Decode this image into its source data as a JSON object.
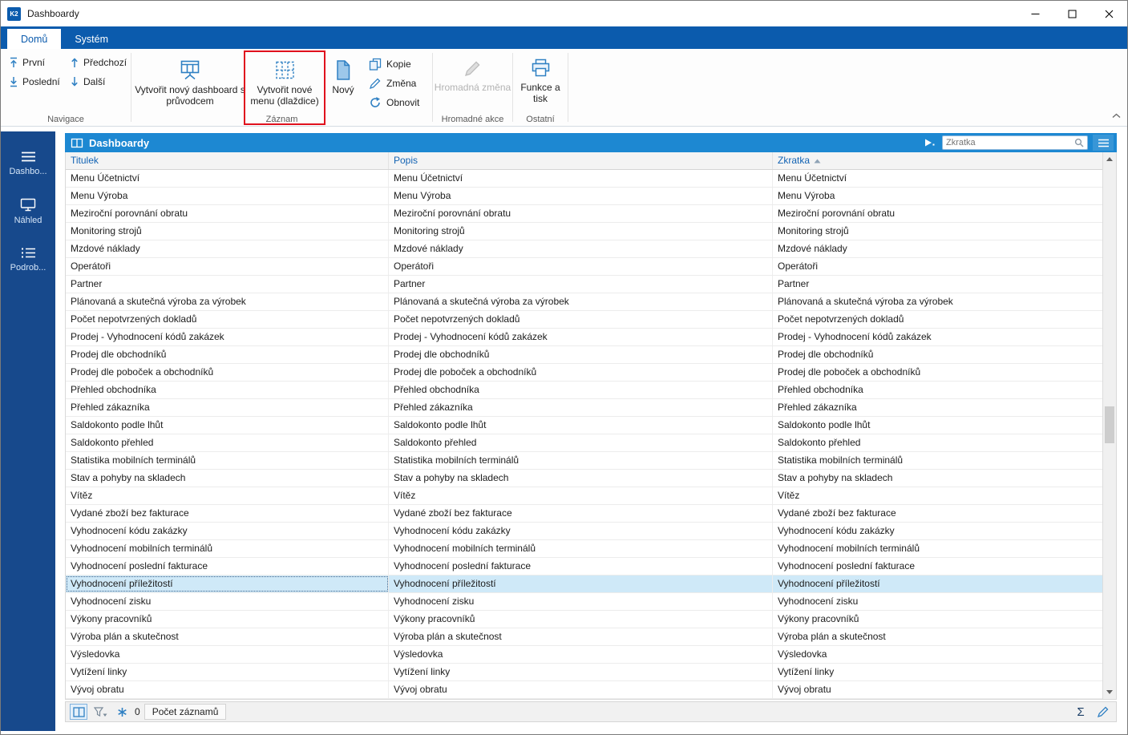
{
  "window": {
    "logo": "K2",
    "title": "Dashboardy"
  },
  "ribbon": {
    "tabs": [
      {
        "label": "Domů"
      },
      {
        "label": "Systém"
      }
    ],
    "navigace": {
      "label": "Navigace",
      "items": [
        {
          "label": "První"
        },
        {
          "label": "Poslední"
        },
        {
          "label": "Předchozí"
        },
        {
          "label": "Další"
        }
      ]
    },
    "zaznam": {
      "label": "Záznam",
      "create_dashboard": "Vytvořit nový dashboard s průvodcem",
      "create_menu": "Vytvořit nové menu (dlaždice)",
      "novy": "Nový",
      "kopie": "Kopie",
      "zmena": "Změna",
      "obnovit": "Obnovit"
    },
    "hromadne_akce": {
      "label": "Hromadné akce",
      "hromadna_zmena": "Hromadná změna"
    },
    "ostatni": {
      "label": "Ostatní",
      "funkce_a_tisk": "Funkce a tisk"
    }
  },
  "sidebar": {
    "items": [
      {
        "label": "Dashbo..."
      },
      {
        "label": "Náhled"
      },
      {
        "label": "Podrob..."
      }
    ]
  },
  "table": {
    "title": "Dashboardy",
    "search_placeholder": "Zkratka",
    "columns": [
      {
        "label": "Titulek"
      },
      {
        "label": "Popis"
      },
      {
        "label": "Zkratka",
        "sorted": "asc"
      }
    ],
    "selected_row": "Vyhodnocení příležitostí",
    "rows": [
      "Menu Účetnictví",
      "Menu Výroba",
      "Meziroční porovnání obratu",
      "Monitoring strojů",
      "Mzdové náklady",
      "Operátoři",
      "Partner",
      "Plánovaná a skutečná výroba za výrobek",
      "Počet nepotvrzených dokladů",
      "Prodej - Vyhodnocení kódů zakázek",
      "Prodej dle obchodníků",
      "Prodej dle poboček a obchodníků",
      "Přehled obchodníka",
      "Přehled zákazníka",
      "Saldokonto podle lhůt",
      "Saldokonto přehled",
      "Statistika mobilních terminálů",
      "Stav a pohyby na skladech",
      "Vítěz",
      "Vydané zboží bez fakturace",
      "Vyhodnocení kódu zakázky",
      "Vyhodnocení mobilních terminálů",
      "Vyhodnocení poslední fakturace",
      "Vyhodnocení příležitostí",
      "Vyhodnocení zisku",
      "Výkony pracovníků",
      "Výroba plán a skutečnost",
      "Výsledovka",
      "Vytížení linky",
      "Vývoj obratu"
    ]
  },
  "statusbar": {
    "filter_count": "0",
    "records_button": "Počet záznamů"
  },
  "colors": {
    "accent_blue": "#0b5bad",
    "sidebar_blue": "#17498c",
    "panel_blue": "#1d88d2",
    "icon_blue": "#2f80c3",
    "selected_row": "#cfe9f8",
    "highlight_red": "#e0111d"
  }
}
